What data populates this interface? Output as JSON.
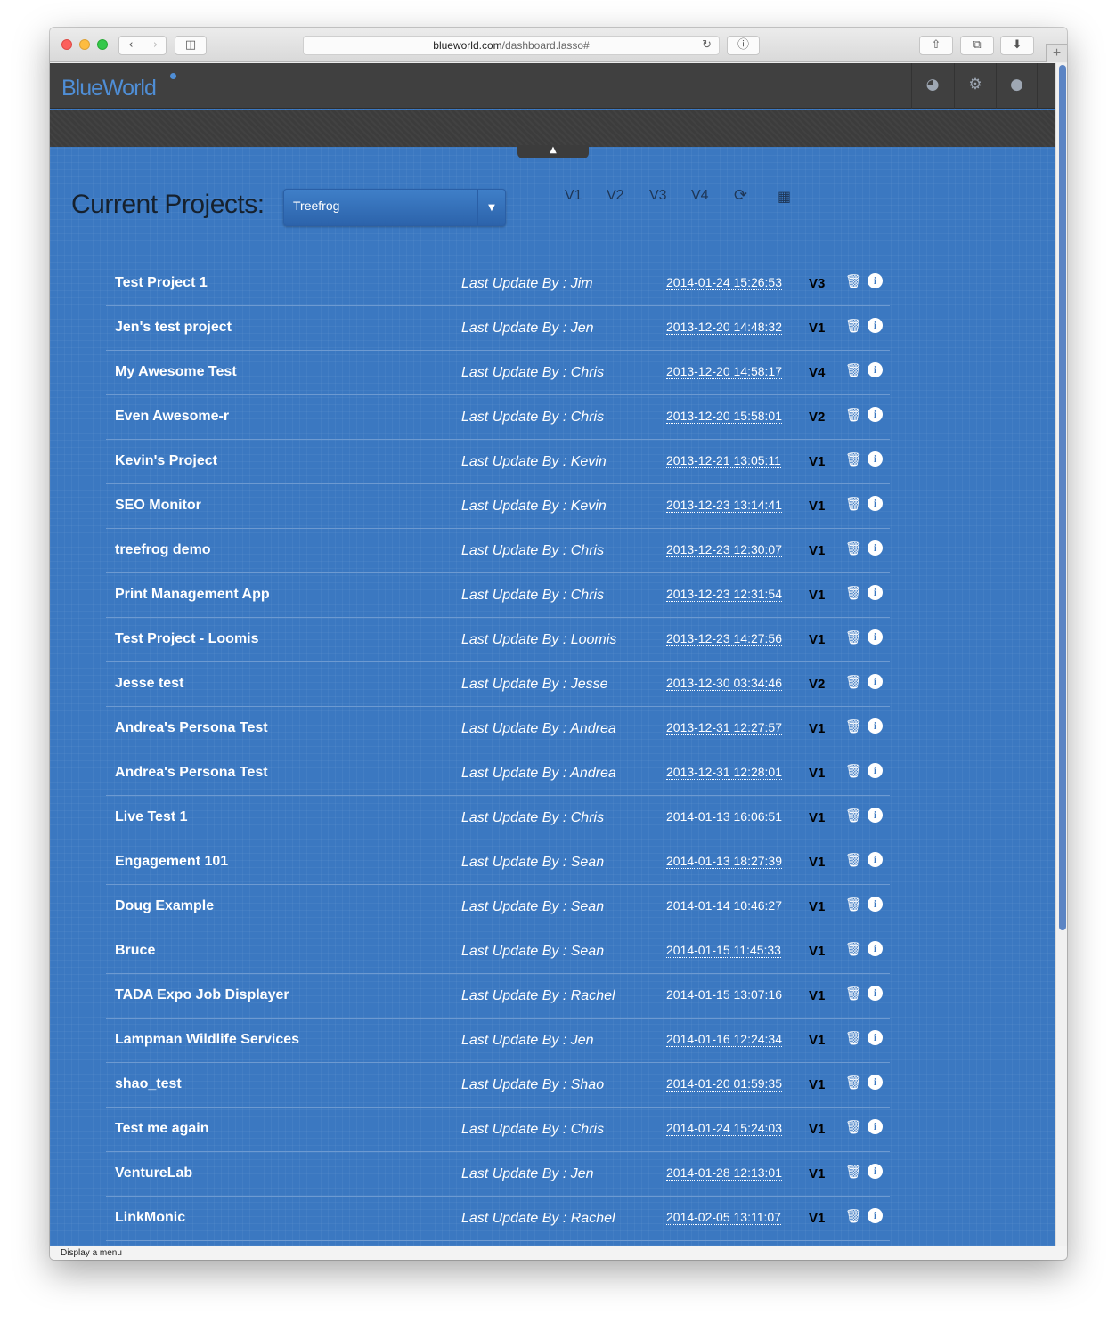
{
  "browser": {
    "url_host": "blueworld.com",
    "url_path": "/dashboard.lasso#",
    "status_text": "Display a menu"
  },
  "app": {
    "logo": "BlueWorld",
    "accent": "#3b78c1"
  },
  "header": {
    "title": "Current Projects:",
    "selected_project": "Treefrog",
    "version_filters": [
      "V1",
      "V2",
      "V3",
      "V4"
    ]
  },
  "projects": [
    {
      "name": "Test Project 1",
      "updated_by": "Last Update By : Jim",
      "date": "2014-01-24 15:26:53",
      "version": "V3"
    },
    {
      "name": "Jen's test project",
      "updated_by": "Last Update By : Jen",
      "date": "2013-12-20 14:48:32",
      "version": "V1"
    },
    {
      "name": "My Awesome Test",
      "updated_by": "Last Update By : Chris",
      "date": "2013-12-20 14:58:17",
      "version": "V4"
    },
    {
      "name": "Even Awesome-r",
      "updated_by": "Last Update By : Chris",
      "date": "2013-12-20 15:58:01",
      "version": "V2"
    },
    {
      "name": "Kevin's Project",
      "updated_by": "Last Update By : Kevin",
      "date": "2013-12-21 13:05:11",
      "version": "V1"
    },
    {
      "name": "SEO Monitor",
      "updated_by": "Last Update By : Kevin",
      "date": "2013-12-23 13:14:41",
      "version": "V1"
    },
    {
      "name": "treefrog demo",
      "updated_by": "Last Update By : Chris",
      "date": "2013-12-23 12:30:07",
      "version": "V1"
    },
    {
      "name": "Print Management App",
      "updated_by": "Last Update By : Chris",
      "date": "2013-12-23 12:31:54",
      "version": "V1"
    },
    {
      "name": "Test Project - Loomis",
      "updated_by": "Last Update By : Loomis",
      "date": "2013-12-23 14:27:56",
      "version": "V1"
    },
    {
      "name": "Jesse test",
      "updated_by": "Last Update By : Jesse",
      "date": "2013-12-30 03:34:46",
      "version": "V2"
    },
    {
      "name": "Andrea's Persona Test",
      "updated_by": "Last Update By : Andrea",
      "date": "2013-12-31 12:27:57",
      "version": "V1"
    },
    {
      "name": "Andrea's Persona Test",
      "updated_by": "Last Update By : Andrea",
      "date": "2013-12-31 12:28:01",
      "version": "V1"
    },
    {
      "name": "Live Test 1",
      "updated_by": "Last Update By : Chris",
      "date": "2014-01-13 16:06:51",
      "version": "V1"
    },
    {
      "name": "Engagement 101",
      "updated_by": "Last Update By : Sean",
      "date": "2014-01-13 18:27:39",
      "version": "V1"
    },
    {
      "name": "Doug Example",
      "updated_by": "Last Update By : Sean",
      "date": "2014-01-14 10:46:27",
      "version": "V1"
    },
    {
      "name": "Bruce",
      "updated_by": "Last Update By : Sean",
      "date": "2014-01-15 11:45:33",
      "version": "V1"
    },
    {
      "name": "TADA Expo Job Displayer",
      "updated_by": "Last Update By : Rachel",
      "date": "2014-01-15 13:07:16",
      "version": "V1"
    },
    {
      "name": "Lampman Wildlife Services",
      "updated_by": "Last Update By : Jen",
      "date": "2014-01-16 12:24:34",
      "version": "V1"
    },
    {
      "name": "shao_test",
      "updated_by": "Last Update By : Shao",
      "date": "2014-01-20 01:59:35",
      "version": "V1"
    },
    {
      "name": "Test me again",
      "updated_by": "Last Update By : Chris",
      "date": "2014-01-24 15:24:03",
      "version": "V1"
    },
    {
      "name": "VentureLab",
      "updated_by": "Last Update By : Jen",
      "date": "2014-01-28 12:13:01",
      "version": "V1"
    },
    {
      "name": "LinkMonic",
      "updated_by": "Last Update By : Rachel",
      "date": "2014-02-05 13:11:07",
      "version": "V1"
    }
  ],
  "icons": {
    "trash": "trash-icon",
    "info": "info-icon",
    "refresh": "refresh-icon",
    "grid": "grid-icon",
    "dashboard": "dashboard-icon",
    "gears": "gears-icon",
    "user": "user-icon"
  }
}
